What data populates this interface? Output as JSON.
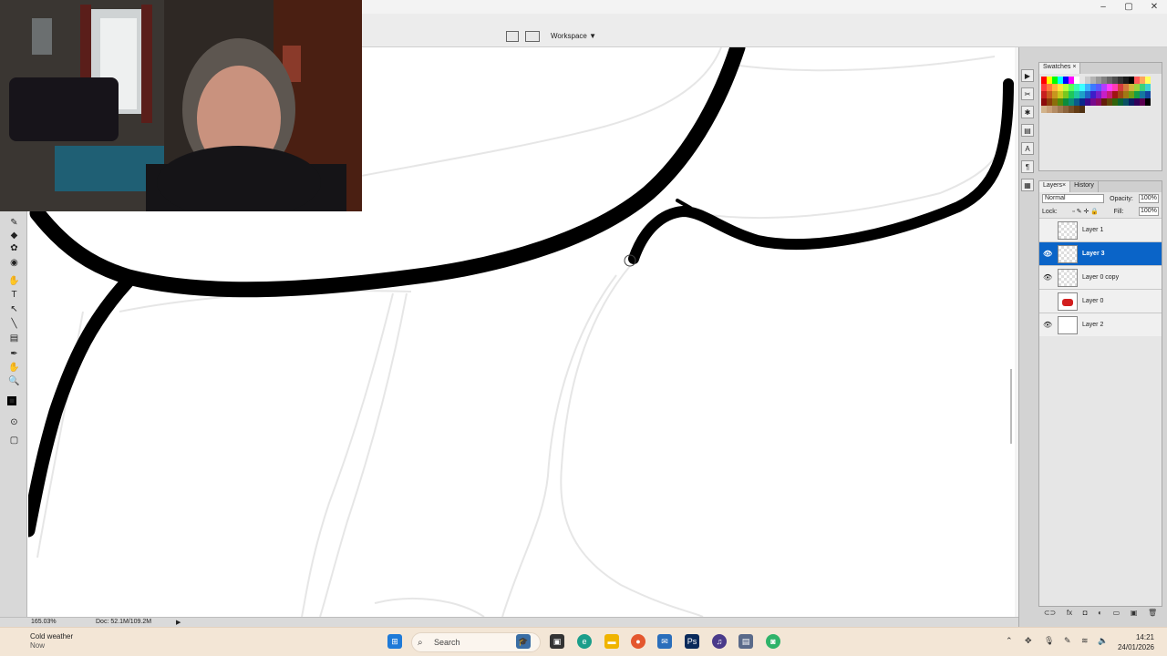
{
  "options_bar": {
    "workspace_label": "Workspace ▼"
  },
  "window_controls": {
    "minimize": "–",
    "maximize": "▢",
    "close": "✕"
  },
  "toolbox": {
    "tools": [
      "✎",
      "◆",
      "✿",
      "◉",
      "✋",
      "T",
      "↖",
      "╲",
      "▤",
      "✒",
      "✋",
      "🔍",
      "■",
      "⊙",
      "▢"
    ]
  },
  "status": {
    "zoom": "165.03%",
    "doc_info": "Doc: 52.1M/109.2M",
    "arrow": "▶"
  },
  "swatches": {
    "tab_label": "Swatches",
    "close": "×",
    "colors": [
      "#ff0000",
      "#ffff00",
      "#00ff00",
      "#00ffff",
      "#0000ff",
      "#ff00ff",
      "#ffffff",
      "#e6e6e6",
      "#cccccc",
      "#b3b3b3",
      "#999999",
      "#808080",
      "#666666",
      "#4d4d4d",
      "#333333",
      "#1a1a1a",
      "#000000",
      "#ff5a5a",
      "#ffa55a",
      "#ffff5a",
      "#ff3c3c",
      "#ff7a3c",
      "#ffb43c",
      "#ffe43c",
      "#b4ff3c",
      "#5aff5a",
      "#3cffb4",
      "#3cffff",
      "#3cb4ff",
      "#3c7aff",
      "#5a5aff",
      "#b43cff",
      "#ff3cff",
      "#ff3cb4",
      "#d23c3c",
      "#d27a3c",
      "#d2b43c",
      "#9cd23c",
      "#3cd27a",
      "#3cd2d2",
      "#c81e1e",
      "#c85a1e",
      "#c8961e",
      "#c8c81e",
      "#78c81e",
      "#1ec85a",
      "#1ec8a0",
      "#1ea0c8",
      "#1e64c8",
      "#3c1ec8",
      "#781ec8",
      "#c81ec8",
      "#c81e78",
      "#a01414",
      "#a04614",
      "#a07814",
      "#6ea014",
      "#14a046",
      "#1478a0",
      "#1446a0",
      "#8c0a0a",
      "#8c3c0a",
      "#8c6e0a",
      "#508c0a",
      "#0a8c3c",
      "#0a8c78",
      "#0a5a8c",
      "#0a288c",
      "#3c0a8c",
      "#780a8c",
      "#8c0a64",
      "#641e0a",
      "#64460a",
      "#32640a",
      "#0a6432",
      "#0a5064",
      "#0a1e64",
      "#32005a",
      "#5a0050",
      "#000000",
      "#d2b48c",
      "#c8a078",
      "#b48c64",
      "#a07850",
      "#8c643c",
      "#785028",
      "#643c14",
      "#503214"
    ]
  },
  "layers": {
    "tabs": [
      "Layers",
      "History"
    ],
    "close": "×",
    "blend_mode": "Normal",
    "opacity_label": "Opacity:",
    "opacity_value": "100%",
    "lock_label": "Lock:",
    "fill_label": "Fill:",
    "fill_value": "100%",
    "items": [
      {
        "name": "Layer 1",
        "visible": false,
        "selected": false,
        "thumb": "checker"
      },
      {
        "name": "Layer 3",
        "visible": true,
        "selected": true,
        "thumb": "checker"
      },
      {
        "name": "Layer 0 copy",
        "visible": true,
        "selected": false,
        "thumb": "checker"
      },
      {
        "name": "Layer 0",
        "visible": false,
        "selected": false,
        "thumb": "red-figure"
      },
      {
        "name": "Layer 2",
        "visible": true,
        "selected": false,
        "thumb": "white"
      }
    ],
    "bottom_icons": [
      "⊂⊃",
      "fx",
      "◘",
      "◐",
      "▭",
      "▣",
      "🗑"
    ]
  },
  "taskbar": {
    "weather_title": "Cold weather",
    "weather_sub": "Now",
    "search_label": "Search",
    "time": "14:21",
    "date": "24/01/2026"
  }
}
